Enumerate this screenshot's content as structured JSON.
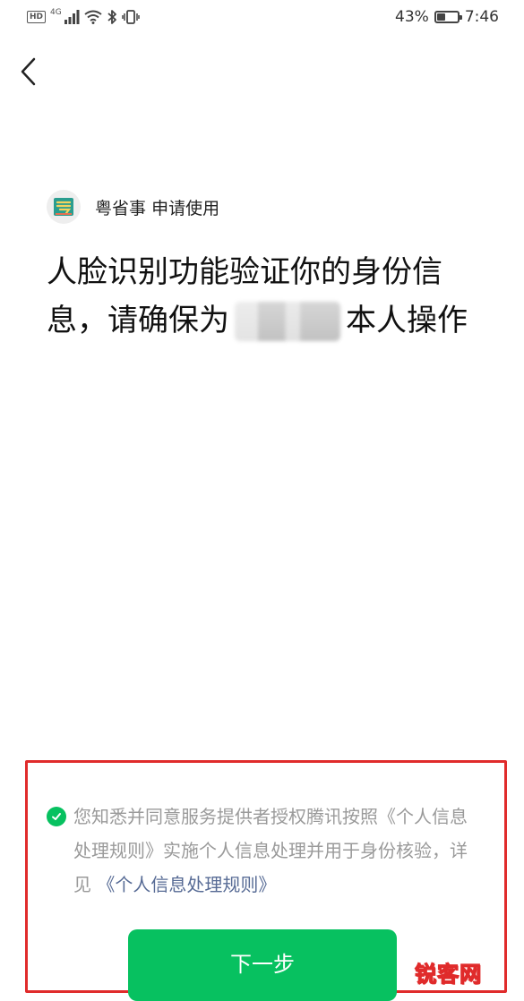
{
  "status_bar": {
    "hd_badge": "HD",
    "network": "4G",
    "battery_percent": "43%",
    "battery_level": 0.43,
    "time": "7:46"
  },
  "icons": {
    "back": "chevron-left-icon",
    "app_logo": "yueshengshi-logo",
    "check": "check-circle-icon"
  },
  "header": {
    "app_name": "粤省事",
    "request_text": "申请使用"
  },
  "main": {
    "text_before_name": "人脸识别功能验证你的身份信息，请确保为",
    "text_after_name": "本人操作"
  },
  "consent": {
    "text": "您知悉并同意服务提供者授权腾讯按照《个人信息处理规则》实施个人信息处理并用于身份核验，详见",
    "link": "《个人信息处理规则》",
    "checked": true
  },
  "button": {
    "next_label": "下一步"
  },
  "watermark": {
    "text": "锐客网"
  },
  "colors": {
    "primary_green": "#07c160",
    "link_blue": "#576b95",
    "annotation_red": "#e02b2b"
  }
}
